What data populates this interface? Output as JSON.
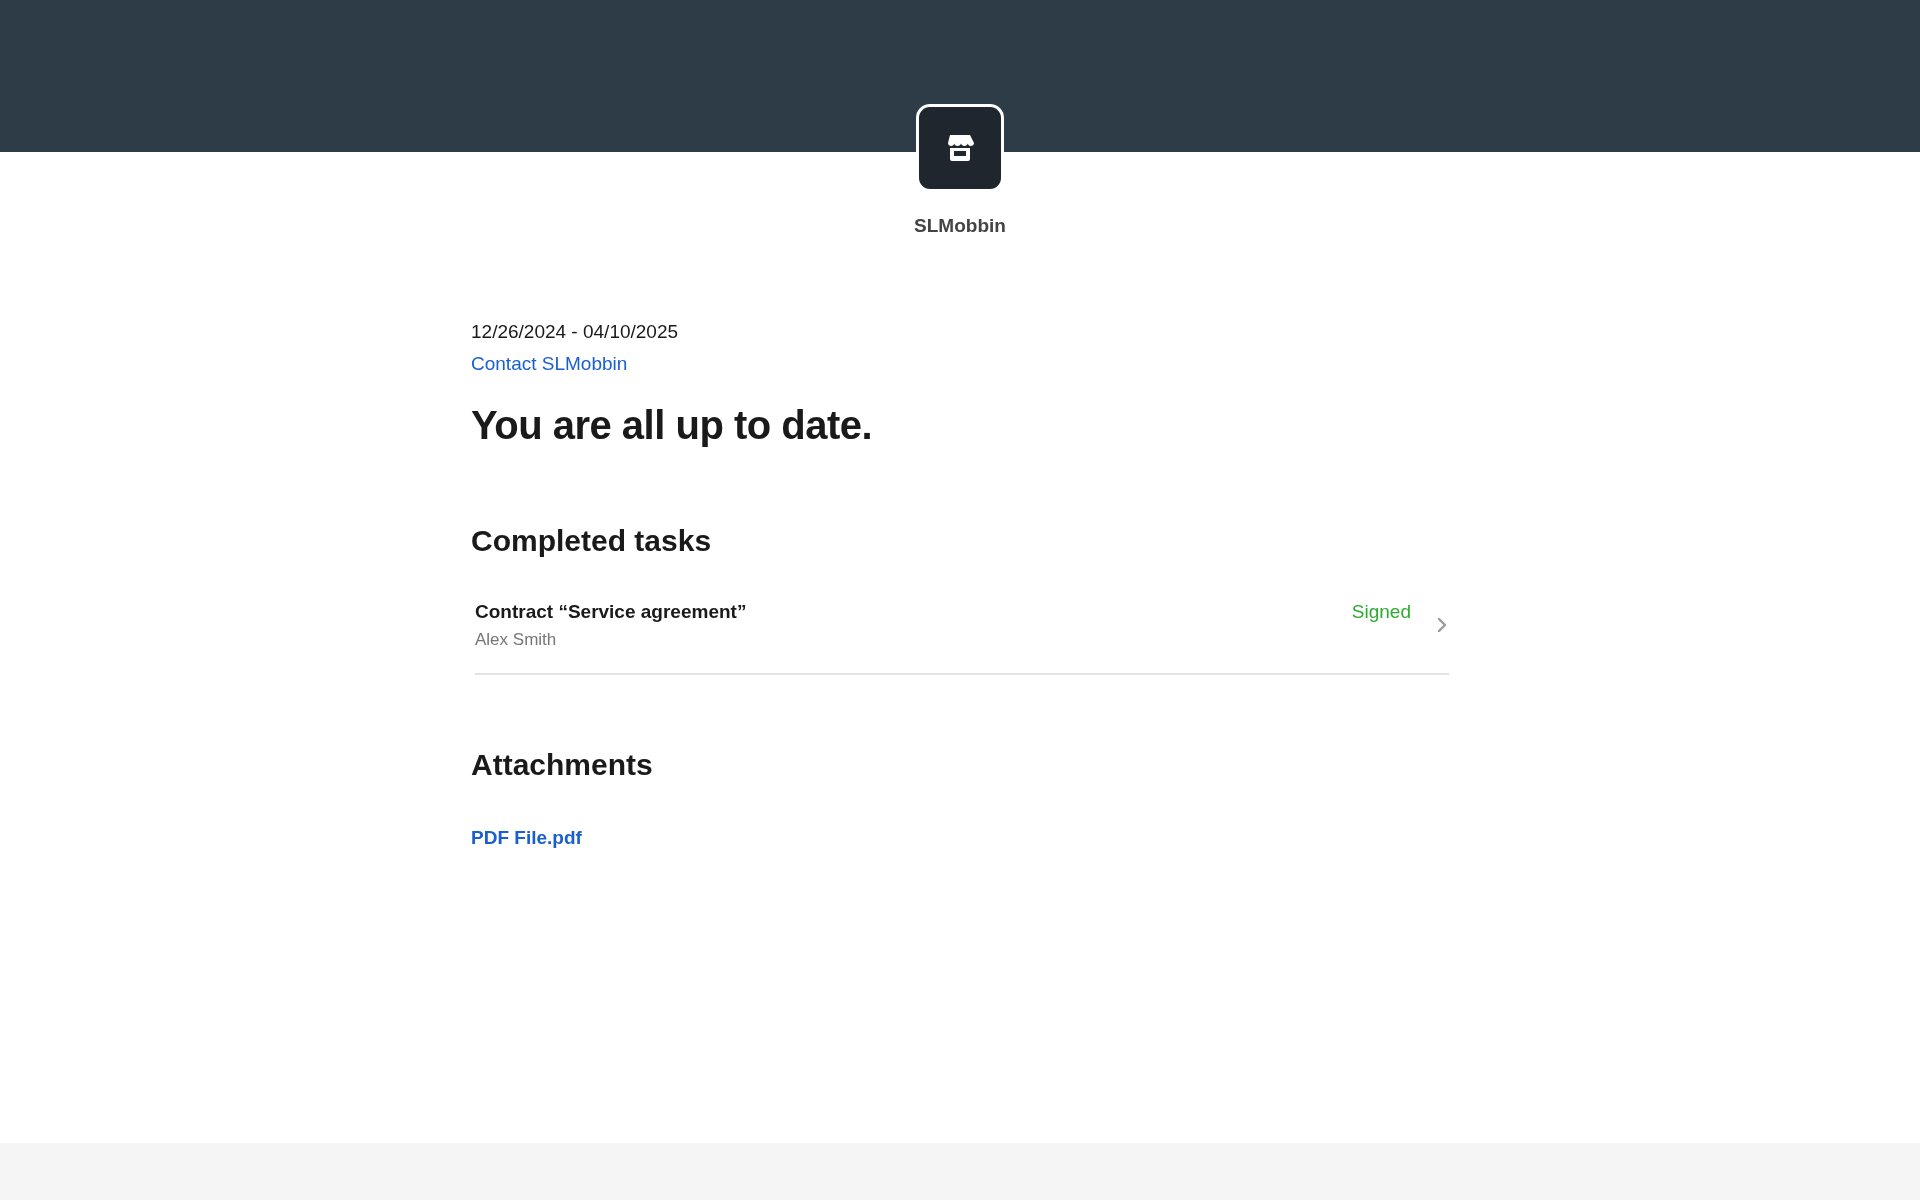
{
  "brand": {
    "name": "SLMobbin"
  },
  "period": "12/26/2024 - 04/10/2025",
  "contact_link": "Contact SLMobbin",
  "heading": "You are all up to date.",
  "completed_tasks": {
    "title": "Completed tasks",
    "items": [
      {
        "title": "Contract “Service agreement”",
        "person": "Alex Smith",
        "status": "Signed"
      }
    ]
  },
  "attachments": {
    "title": "Attachments",
    "files": [
      "PDF File.pdf"
    ]
  }
}
